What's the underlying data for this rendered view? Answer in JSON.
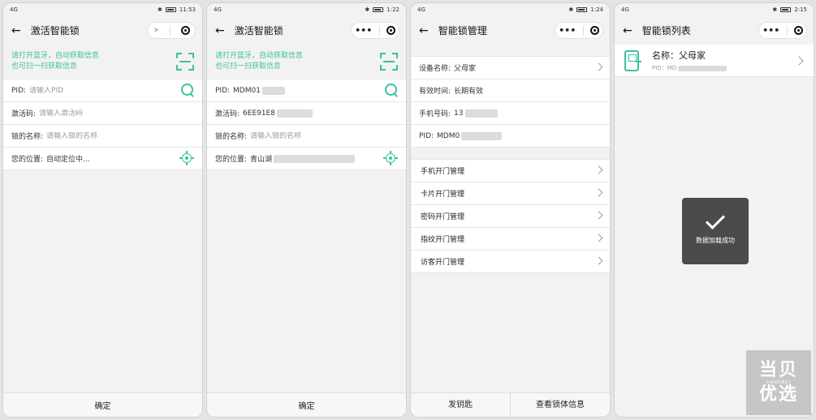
{
  "phone1": {
    "time": "11:53",
    "signal": "4G",
    "title": "激活智能锁",
    "tip_line1": "请打开蓝牙，自动获取信息",
    "tip_line2": "也可扫一扫获取信息",
    "pid_label": "PID:",
    "pid_placeholder": "请输入PID",
    "code_label": "激活码:",
    "code_placeholder": "请输入激活码",
    "name_label": "锁的名称:",
    "name_placeholder": "请输入锁的名称",
    "loc_label": "您的位置:",
    "loc_value": "自动定位中...",
    "confirm": "确定"
  },
  "phone2": {
    "time": "1:22",
    "signal": "4G",
    "title": "激活智能锁",
    "tip_line1": "请打开蓝牙，自动获取信息",
    "tip_line2": "也可扫一扫获取信息",
    "pid_label": "PID:",
    "pid_value": "MDM01",
    "code_label": "激活码:",
    "code_value": "6EE91E8",
    "name_label": "锁的名称:",
    "name_placeholder": "请输入锁的名称",
    "loc_label": "您的位置:",
    "loc_value": "青山湖",
    "confirm": "确定"
  },
  "phone3": {
    "time": "1:24",
    "signal": "4G",
    "title": "智能锁管理",
    "device_label": "设备名称:",
    "device_value": "父母家",
    "valid_label": "有效时间:",
    "valid_value": "长期有效",
    "phone_label": "手机号码:",
    "phone_value": "13",
    "pid_label": "PID:",
    "pid_value": "MDM0",
    "menu": [
      "手机开门管理",
      "卡片开门管理",
      "密码开门管理",
      "指纹开门管理",
      "访客开门管理"
    ],
    "btn_key": "发钥匙",
    "btn_info": "查看锁体信息"
  },
  "phone4": {
    "time": "2:15",
    "signal": "4G",
    "title": "智能锁列表",
    "item_name": "名称：父母家",
    "item_pid": "PID：MD",
    "toast": "数据加载成功"
  },
  "watermark": {
    "line1": "当贝",
    "line2": "DANGBEI",
    "line3": "优选"
  },
  "colors": {
    "accent": "#3cc2a0",
    "toast_bg": "#4b4b4b"
  }
}
